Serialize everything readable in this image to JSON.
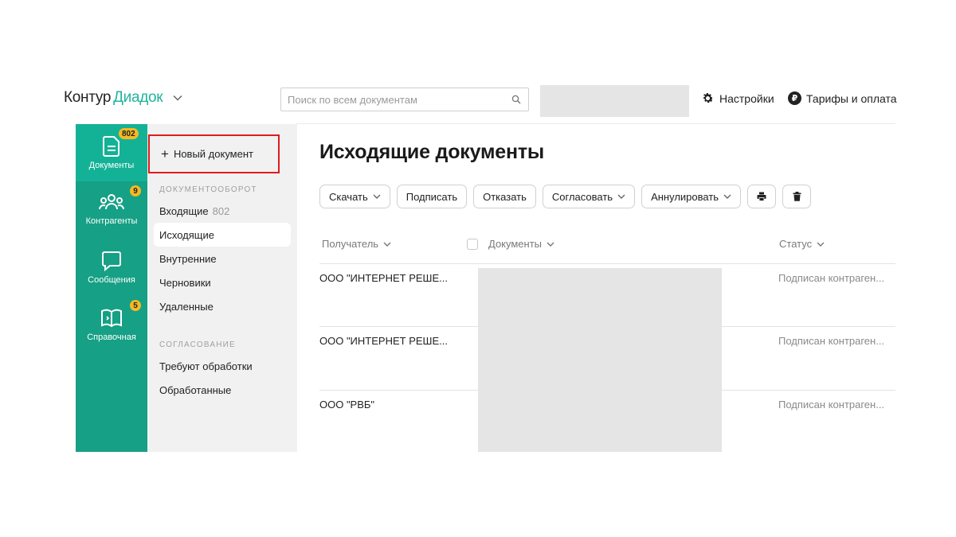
{
  "header": {
    "logo_part1": "Контур",
    "logo_part2": "Диадок",
    "search_placeholder": "Поиск по всем документам",
    "settings_label": "Настройки",
    "tariffs_label": "Тарифы и оплата",
    "tariffs_icon_glyph": "₽"
  },
  "rail": [
    {
      "label": "Документы",
      "badge": "802",
      "icon": "document-icon"
    },
    {
      "label": "Контрагенты",
      "badge": "9",
      "icon": "people-icon"
    },
    {
      "label": "Сообщения",
      "badge": "",
      "icon": "chat-icon"
    },
    {
      "label": "Справочная",
      "badge": "5",
      "icon": "book-icon"
    }
  ],
  "subnav": {
    "new_document": "Новый документ",
    "section1_title": "ДОКУМЕНТООБОРОТ",
    "inbox_label": "Входящие",
    "inbox_count": "802",
    "outgoing_label": "Исходящие",
    "internal_label": "Внутренние",
    "drafts_label": "Черновики",
    "deleted_label": "Удаленные",
    "section2_title": "СОГЛАСОВАНИЕ",
    "requires_processing": "Требуют обработки",
    "processed": "Обработанные"
  },
  "main": {
    "title": "Исходящие документы",
    "toolbar": {
      "download": "Скачать",
      "sign": "Подписать",
      "refuse": "Отказать",
      "approve": "Согласовать",
      "annul": "Аннулировать"
    },
    "columns": {
      "recipient": "Получатель",
      "documents": "Документы",
      "status": "Статус"
    },
    "rows": [
      {
        "recipient": "ООО \"ИНТЕРНЕТ РЕШЕ...",
        "status": "Подписан контраген..."
      },
      {
        "recipient": "ООО \"ИНТЕРНЕТ РЕШЕ...",
        "status": "Подписан контраген..."
      },
      {
        "recipient": "ООО \"РВБ\"",
        "status": "Подписан контраген..."
      }
    ]
  },
  "colors": {
    "brand_green": "#16a085",
    "brand_green_active": "#13b296",
    "badge_yellow": "#f5b922",
    "highlight_red": "#e01b1b"
  }
}
